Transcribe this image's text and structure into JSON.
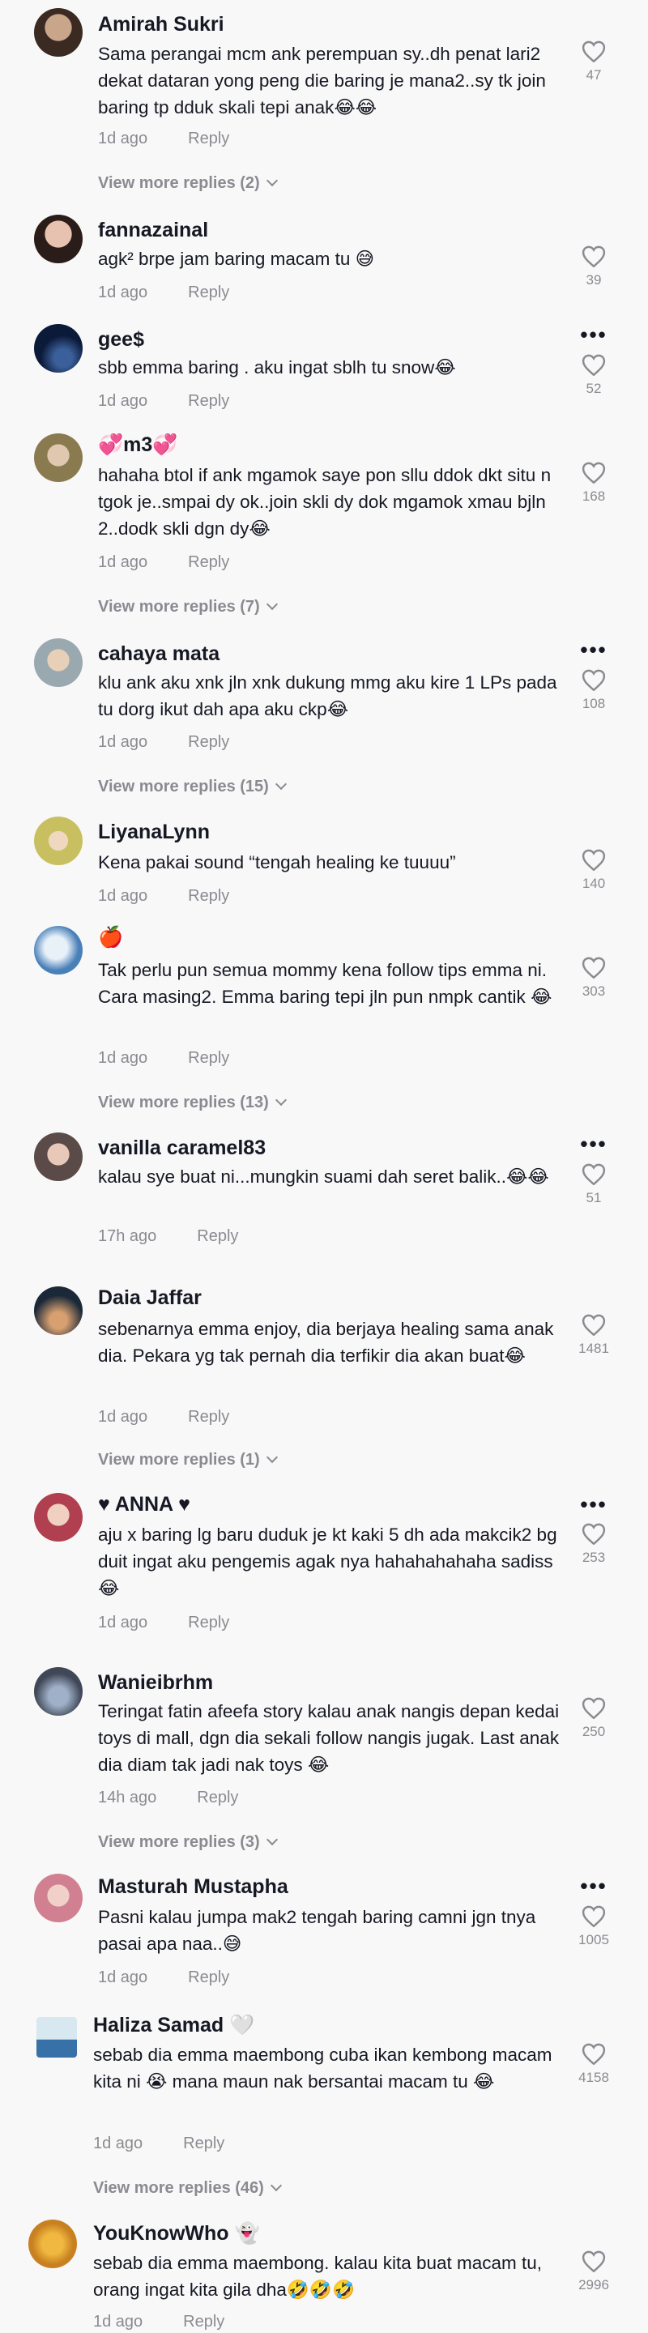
{
  "comments": [
    {
      "user": "Amirah Sukri",
      "text": "Sama perangai mcm ank perempuan sy..dh penat lari2 dekat dataran yong peng die baring je mana2..sy tk join baring tp dduk skali tepi anak😂😂",
      "time": "1d ago",
      "reply": "Reply",
      "likes": "47",
      "view_replies": "View more replies (2)"
    },
    {
      "user": "fannazainal",
      "text": "agk² brpe jam baring macam tu 😅",
      "time": "1d ago",
      "reply": "Reply",
      "likes": "39"
    },
    {
      "user": "gee$",
      "text": "sbb emma baring . aku ingat sblh tu snow😂",
      "time": "1d ago",
      "reply": "Reply",
      "likes": "52"
    },
    {
      "user": "💞m3💞",
      "text": "hahaha btol if ank mgamok saye pon sllu ddok dkt situ n tgok je..smpai dy ok..join skli dy dok mgamok xmau bjln 2..dodk skli dgn dy😂",
      "time": "1d ago",
      "reply": "Reply",
      "likes": "168",
      "view_replies": "View more replies (7)"
    },
    {
      "user": "cahaya mata",
      "text": "klu ank aku xnk jln xnk dukung mmg aku kire 1 LPs pada tu dorg ikut dah apa aku ckp😂",
      "time": "1d ago",
      "reply": "Reply",
      "likes": "108",
      "view_replies": "View more replies (15)"
    },
    {
      "user": "LiyanaLynn",
      "text": "Kena pakai sound “tengah healing ke tuuuu”",
      "time": "1d ago",
      "reply": "Reply",
      "likes": "140"
    },
    {
      "user": "🍎",
      "text": "Tak perlu pun semua mommy kena follow tips emma ni. Cara masing2. Emma baring tepi jln pun nmpk cantik 😂",
      "time": "1d ago",
      "reply": "Reply",
      "likes": "303",
      "view_replies": "View more replies (13)"
    },
    {
      "user": "vanilla caramel83",
      "text": "kalau sye buat ni...mungkin suami dah seret balik..😂😂",
      "time": "17h ago",
      "reply": "Reply",
      "likes": "51"
    },
    {
      "user": "Daia Jaffar",
      "text": "sebenarnya emma enjoy, dia berjaya healing sama anak dia. Pekara yg tak pernah dia terfikir dia akan buat😂",
      "time": "1d ago",
      "reply": "Reply",
      "likes": "1481",
      "view_replies": "View more replies (1)"
    },
    {
      "user": "♥ ANNA ♥",
      "text": "aju x baring lg baru duduk je kt kaki 5 dh ada makcik2 bg duit ingat aku pengemis agak nya hahahahahaha sadiss 😂",
      "time": "1d ago",
      "reply": "Reply",
      "likes": "253"
    },
    {
      "user": "Wanieibrhm",
      "text": "Teringat fatin afeefa story kalau anak nangis depan kedai toys di mall, dgn dia sekali follow nangis jugak. Last anak dia diam tak jadi nak toys 😂",
      "time": "14h ago",
      "reply": "Reply",
      "likes": "250",
      "view_replies": "View more replies (3)"
    },
    {
      "user": "Masturah Mustapha",
      "text": "Pasni kalau jumpa mak2 tengah baring camni jgn tnya pasai apa naa..😅",
      "time": "1d ago",
      "reply": "Reply",
      "likes": "1005"
    },
    {
      "user": "Haliza Samad 🤍",
      "text": "sebab dia emma maembong cuba ikan kembong macam kita ni 😭 mana maun nak bersantai macam tu 😂",
      "time": "1d ago",
      "reply": "Reply",
      "likes": "4158",
      "view_replies": "View more replies (46)"
    },
    {
      "user": "YouKnowWho 👻",
      "text": "sebab dia emma maembong. kalau kita buat macam tu, orang ingat kita gila dha🤣🤣🤣",
      "time": "1d ago",
      "reply": "Reply",
      "likes": "2996"
    }
  ],
  "icons": {
    "like": "heart-outline-icon",
    "more": "more-options-icon",
    "expand": "chevron-down-icon"
  },
  "colors": {
    "text": "#161823",
    "muted": "#8a8b91",
    "background": "#f8f8f8"
  }
}
